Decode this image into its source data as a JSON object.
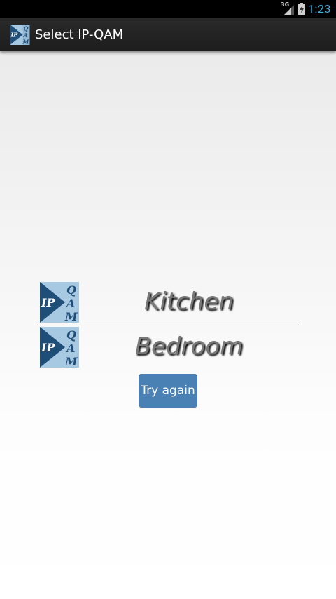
{
  "status_bar": {
    "network_type": "3G",
    "time": "1:23",
    "clock_color": "#33b5e5"
  },
  "action_bar": {
    "icon": "ip-qam-logo",
    "title": "Select IP-QAM"
  },
  "devices": [
    {
      "name": "Kitchen",
      "icon": "ip-qam-logo"
    },
    {
      "name": "Bedroom",
      "icon": "ip-qam-logo"
    }
  ],
  "logo_text": {
    "ip": "IP",
    "q": "Q",
    "a": "A",
    "m": "M"
  },
  "try_again_label": "Try again",
  "colors": {
    "button": "#4a81b5",
    "logo_dark": "#1f4e79",
    "logo_light": "#a8c9e2"
  }
}
